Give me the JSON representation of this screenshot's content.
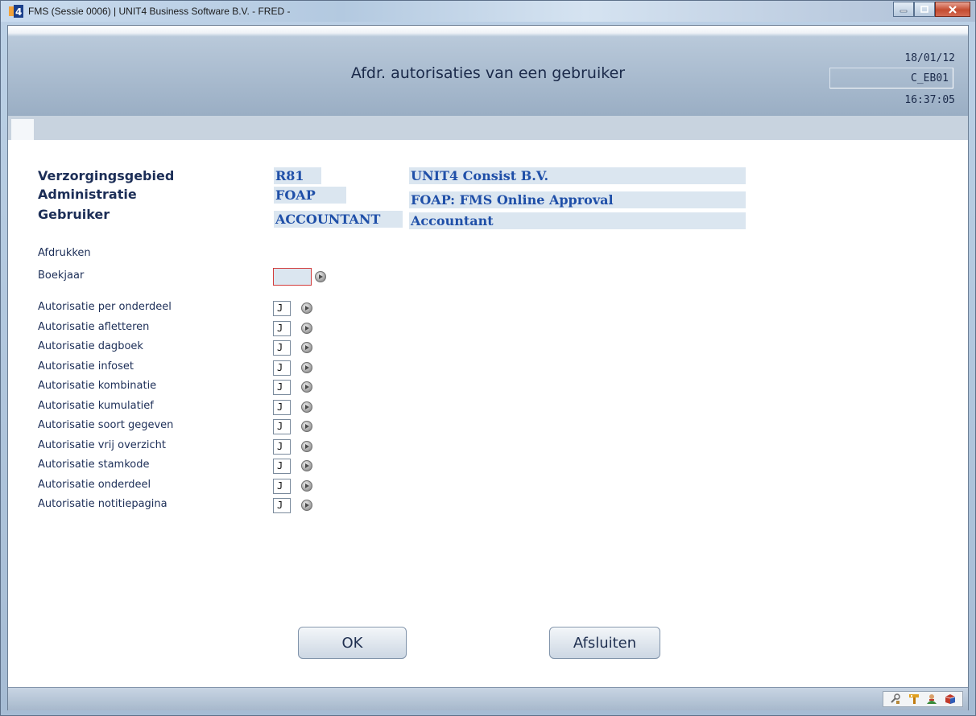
{
  "window": {
    "title": "FMS (Sessie 0006) | UNIT4 Business Software B.V. - FRED -"
  },
  "header": {
    "title": "Afdr. autorisaties van een gebruiker",
    "date": "18/01/12",
    "program": "C_EB01",
    "time": "16:37:05"
  },
  "context": {
    "rows": [
      {
        "label": "Verzorgingsgebied",
        "code": "R81",
        "description": "UNIT4 Consist B.V."
      },
      {
        "label": "Administratie",
        "code": "FOAP",
        "description": "FOAP: FMS Online Approval"
      },
      {
        "label": "Gebruiker",
        "code": "ACCOUNTANT",
        "description": "Accountant"
      }
    ]
  },
  "form": {
    "section_label": "Afdrukken",
    "boekjaar": {
      "label": "Boekjaar",
      "value": ""
    },
    "authorizations": [
      {
        "label": "Autorisatie per onderdeel",
        "value": "J"
      },
      {
        "label": "Autorisatie afletteren",
        "value": "J"
      },
      {
        "label": "Autorisatie dagboek",
        "value": "J"
      },
      {
        "label": "Autorisatie infoset",
        "value": "J"
      },
      {
        "label": "Autorisatie kombinatie",
        "value": "J"
      },
      {
        "label": "Autorisatie kumulatief",
        "value": "J"
      },
      {
        "label": "Autorisatie soort gegeven",
        "value": "J"
      },
      {
        "label": "Autorisatie vrij overzicht",
        "value": "J"
      },
      {
        "label": "Autorisatie stamkode",
        "value": "J"
      },
      {
        "label": "Autorisatie onderdeel",
        "value": "J"
      },
      {
        "label": "Autorisatie notitiepagina",
        "value": "J"
      }
    ]
  },
  "buttons": {
    "ok": "OK",
    "close": "Afsluiten"
  },
  "footer_icons": [
    "tools-icon",
    "help-icon",
    "user-icon",
    "box-icon"
  ],
  "colors": {
    "accent": "#1f4fa8",
    "invalid_border": "#d23b3b"
  }
}
